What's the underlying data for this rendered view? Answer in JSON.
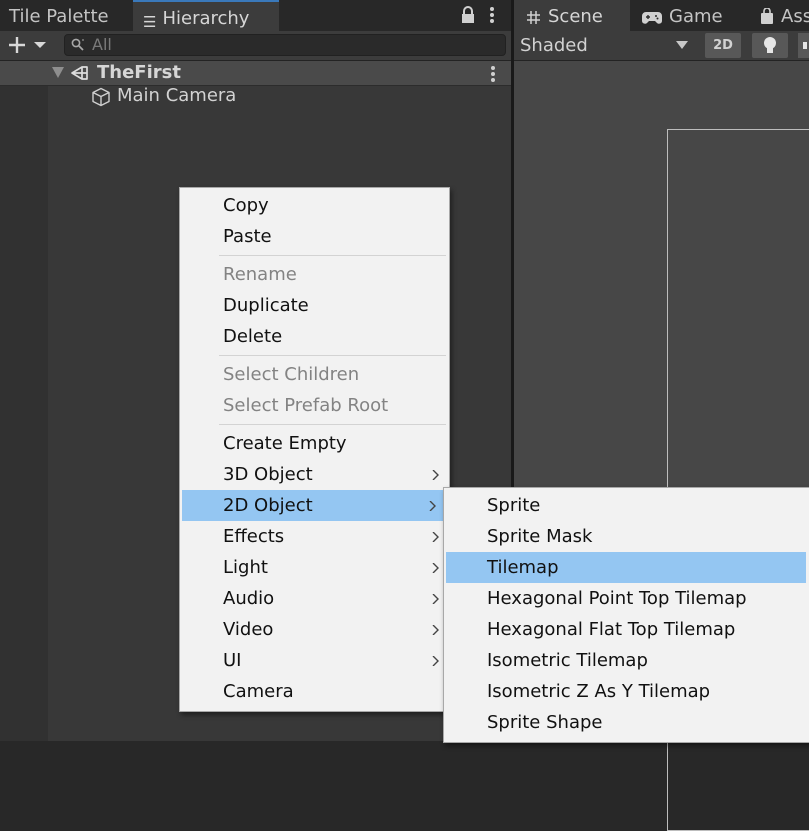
{
  "hierarchy_panel": {
    "tabs": [
      {
        "label": "Tile Palette",
        "icon": "none"
      },
      {
        "label": "Hierarchy",
        "icon": "hierarchy-list-icon"
      }
    ],
    "search": {
      "placeholder": "All",
      "value": ""
    },
    "scene": {
      "name": "TheFirst",
      "icon": "unity-logo-icon",
      "expanded": true
    },
    "objects": [
      {
        "label": "Main Camera",
        "icon": "gameobject-cube-icon"
      }
    ]
  },
  "scene_panel": {
    "tabs": [
      {
        "label": "Scene",
        "icon": "grid-icon"
      },
      {
        "label": "Game",
        "icon": "gamepad-icon"
      },
      {
        "label": "Ass",
        "icon": "bag-icon"
      }
    ],
    "toolbar": {
      "draw_mode": "Shaded",
      "toggle_2d": "2D",
      "light_icon": "lightbulb-icon",
      "audio_icon": "speaker-icon"
    }
  },
  "context_menu": {
    "groups": [
      [
        {
          "label": "Copy"
        },
        {
          "label": "Paste"
        }
      ],
      [
        {
          "label": "Rename",
          "disabled": true
        },
        {
          "label": "Duplicate"
        },
        {
          "label": "Delete"
        }
      ],
      [
        {
          "label": "Select Children",
          "disabled": true
        },
        {
          "label": "Select Prefab Root",
          "disabled": true
        }
      ],
      [
        {
          "label": "Create Empty"
        },
        {
          "label": "3D Object",
          "submenu": true
        },
        {
          "label": "2D Object",
          "submenu": true,
          "highlighted": true
        },
        {
          "label": "Effects",
          "submenu": true
        },
        {
          "label": "Light",
          "submenu": true
        },
        {
          "label": "Audio",
          "submenu": true
        },
        {
          "label": "Video",
          "submenu": true
        },
        {
          "label": "UI",
          "submenu": true
        },
        {
          "label": "Camera"
        }
      ]
    ]
  },
  "submenu_2d_object": {
    "items": [
      {
        "label": "Sprite"
      },
      {
        "label": "Sprite Mask"
      },
      {
        "label": "Tilemap",
        "highlighted": true
      },
      {
        "label": "Hexagonal Point Top Tilemap"
      },
      {
        "label": "Hexagonal Flat Top Tilemap"
      },
      {
        "label": "Isometric Tilemap"
      },
      {
        "label": "Isometric Z As Y Tilemap"
      },
      {
        "label": "Sprite Shape"
      }
    ]
  },
  "colors": {
    "highlight": "#94c6f2",
    "menu_bg": "#f2f2f2",
    "panel_bg": "#383838",
    "active_tab_accent": "#3a79bb"
  }
}
